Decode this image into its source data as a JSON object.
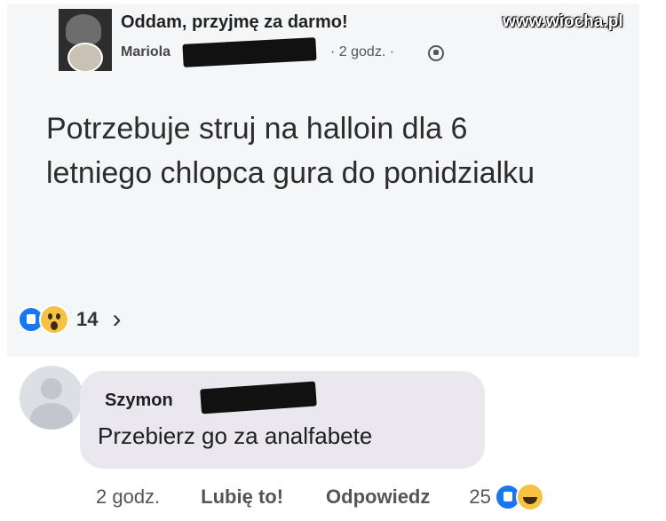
{
  "post": {
    "group_name": "Oddam, przyjmę za darmo!",
    "author": "Mariola",
    "time": "· 2 godz. ·",
    "privacy_icon": "globe-icon",
    "body": "Potrzebuje struj na halloin dla 6 letniego chlopca gura do ponidzialku",
    "reactions": {
      "icons": [
        "like-icon",
        "wow-icon"
      ],
      "count": "14",
      "more_icon": "chevron-right-icon"
    }
  },
  "watermark": "www.wiocha.pl",
  "comment": {
    "author": "Szymon",
    "text": "Przebierz go za analfabete",
    "time": "2 godz.",
    "like_label": "Lubię to!",
    "reply_label": "Odpowiedz",
    "reaction_count": "25",
    "reaction_icons": [
      "like-icon",
      "laugh-icon"
    ]
  },
  "colors": {
    "post_background": "#f5f6f8",
    "comment_bubble": "#eae8ee",
    "like_blue": "#1877f2",
    "emoji_yellow": "#f7c244"
  }
}
